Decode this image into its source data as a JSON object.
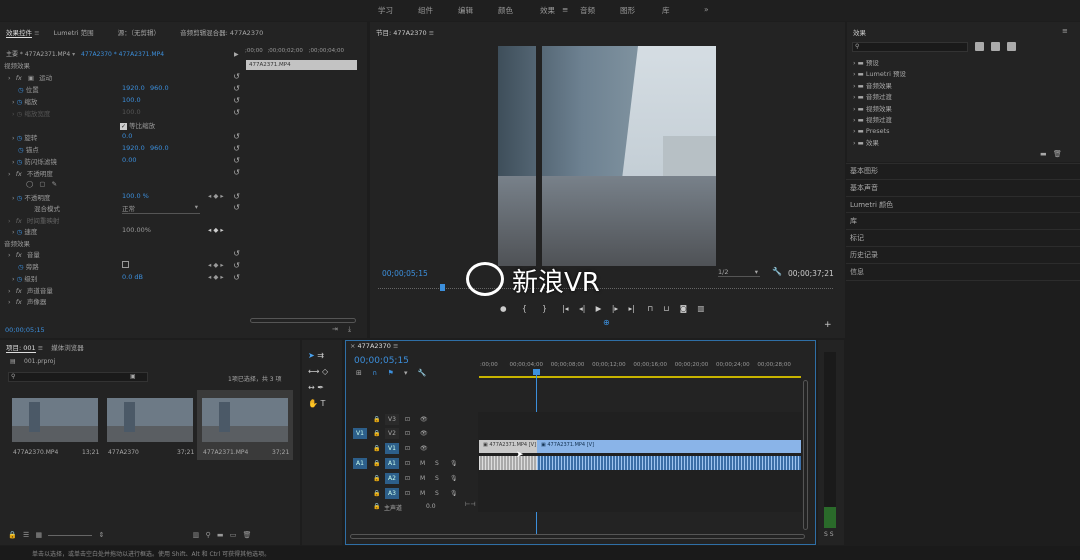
{
  "workspaces": [
    "学习",
    "组件",
    "编辑",
    "颜色",
    "效果",
    "音频",
    "图形",
    "库"
  ],
  "overflow": "»",
  "effect_controls": {
    "tabs": [
      "效果控件",
      "Lumetri 范围",
      "源：（无剪辑）",
      "音频剪辑混合器: 477A2370"
    ],
    "master": "主要 * 477A2371.MP4",
    "active": "477A2370 * 477A2371.MP4",
    "ruler": [
      ";00;00",
      ";00;00;02;00",
      ";00;00;04;00"
    ],
    "clip": "477A2371.MP4",
    "video_effects": "视频效果",
    "motion": "运动",
    "position": "位置",
    "position_x": "1920.0",
    "position_y": "960.0",
    "scale": "缩放",
    "scale_v": "100.0",
    "scale_w": "缩放宽度",
    "scale_w_v": "100.0",
    "uniform": "等比缩放",
    "rotation": "旋转",
    "rotation_v": "0.0",
    "anchor": "锚点",
    "anchor_x": "1920.0",
    "anchor_y": "960.0",
    "flicker": "防闪烁滤镜",
    "flicker_v": "0.00",
    "opacity_fx": "不透明度",
    "opacity": "不透明度",
    "opacity_v": "100.0 %",
    "blend": "混合模式",
    "blend_v": "正常",
    "remap": "时间重映射",
    "speed": "速度",
    "speed_v": "100.00%",
    "audio_effects": "音频效果",
    "volume_fx": "音量",
    "bypass": "旁路",
    "level": "级别",
    "level_v": "0.0 dB",
    "channel_vol": "声道音量",
    "panner": "声像器",
    "timecode": "00;00;05;15"
  },
  "program": {
    "title": "节目: 477A2370",
    "timecode": "00;00;05;15",
    "zoom": "1/2",
    "duration": "00;00;37;21"
  },
  "project": {
    "tabs": [
      "项目: 001",
      "媒体浏览器"
    ],
    "file": "001.prproj",
    "selection": "1项已选择，共 3 项",
    "items": [
      {
        "name": "477A2370.MP4",
        "duration": "13;21"
      },
      {
        "name": "477A2370",
        "duration": "37;21"
      },
      {
        "name": "477A2371.MP4",
        "duration": "37;21"
      }
    ]
  },
  "timeline": {
    "tab": "477A2370",
    "timecode": "00;00;05;15",
    "ruler": [
      ":00;00",
      "00;00;04;00",
      "00;00;08;00",
      "00;00;12;00",
      "00;00;16;00",
      "00;00;20;00",
      "00;00;24;00",
      "00;00;28;00"
    ],
    "video_tracks": [
      "V3",
      "V2",
      "V1"
    ],
    "audio_tracks": [
      "A1",
      "A2",
      "A3"
    ],
    "src_v": "V1",
    "src_a": "A1",
    "master": "主声道",
    "master_v": "0.0",
    "clip1": "477A2371.MP4 [V]",
    "clip2": "477A2371.MP4 [V]"
  },
  "effects_panel": {
    "title": "效果",
    "items": [
      "预设",
      "Lumetri 预设",
      "音频效果",
      "音频过渡",
      "视频效果",
      "视频过渡",
      "Presets",
      "效果"
    ]
  },
  "side_panels": [
    "基本图形",
    "基本声音",
    "Lumetri 颜色",
    "库",
    "标记",
    "历史记录",
    "信息"
  ],
  "meter": "S S",
  "status": "单击以选择，或单击空白处并拖动以进行框选。使用 Shift、Alt 和 Ctrl 可获得其他选项。",
  "watermark": "新浪VR"
}
